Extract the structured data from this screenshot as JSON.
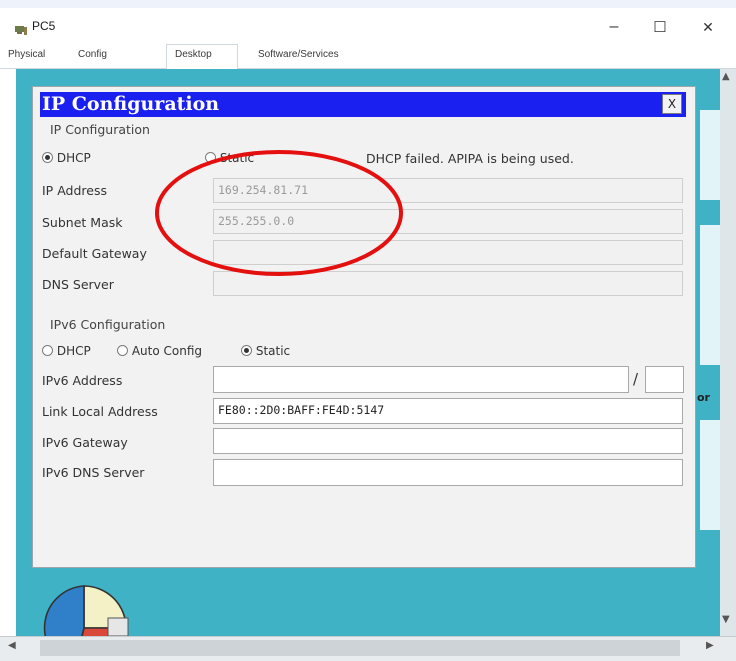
{
  "window": {
    "title": "PC5",
    "top_text": "",
    "controls": {
      "minimize": "–",
      "maximize": "☐",
      "close": "✕"
    }
  },
  "tabs": [
    {
      "label": "Physical"
    },
    {
      "label": "Config"
    },
    {
      "label": "Desktop",
      "selected": true
    },
    {
      "label": "Software/Services"
    }
  ],
  "dialog": {
    "title": "IP Configuration",
    "close_label": "X",
    "ipv4": {
      "group_label": "IP Configuration",
      "dhcp_label": "DHCP",
      "static_label": "Static",
      "mode": "DHCP",
      "status": "DHCP failed. APIPA is being used.",
      "fields": [
        {
          "label": "IP Address",
          "value": "169.254.81.71"
        },
        {
          "label": "Subnet Mask",
          "value": "255.255.0.0"
        },
        {
          "label": "Default Gateway",
          "value": ""
        },
        {
          "label": "DNS Server",
          "value": ""
        }
      ]
    },
    "ipv6": {
      "group_label": "IPv6 Configuration",
      "dhcp_label": "DHCP",
      "auto_label": "Auto Config",
      "static_label": "Static",
      "mode": "Static",
      "fields": [
        {
          "label": "IPv6 Address",
          "value": "",
          "prefix": ""
        },
        {
          "label": "Link Local Address",
          "value": "FE80::2D0:BAFF:FE4D:5147"
        },
        {
          "label": "IPv6 Gateway",
          "value": ""
        },
        {
          "label": "IPv6 DNS Server",
          "value": ""
        }
      ],
      "prefix_separator": "/"
    }
  },
  "background": {
    "side_label": "or"
  },
  "colors": {
    "desktop": "#3fb2c6",
    "dialog_header": "#1a20f0",
    "annotation": "#e3100f"
  }
}
